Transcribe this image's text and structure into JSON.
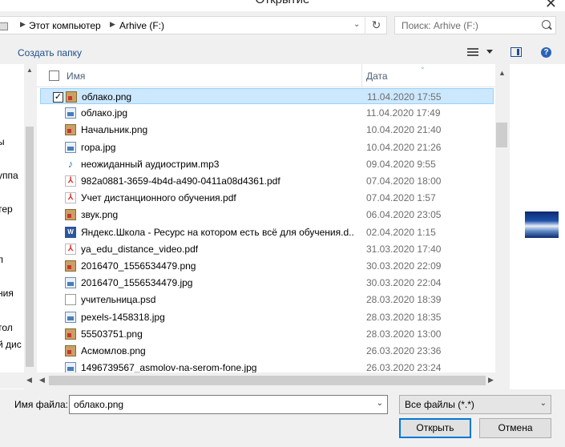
{
  "window": {
    "title": "Открытие"
  },
  "address": {
    "segments": [
      "Этот компьютер",
      "Arhive (F:)"
    ]
  },
  "search": {
    "placeholder": "Поиск: Arhive (F:)"
  },
  "toolbar": {
    "new_folder": "Создать папку",
    "help": "?"
  },
  "nav": {
    "items": [
      "ы",
      "уппа",
      "тер",
      "л",
      "ния",
      "тол",
      "й дис"
    ]
  },
  "columns": {
    "name": "Имя",
    "date": "Дата"
  },
  "files": [
    {
      "name": "облако.png",
      "date": "11.04.2020 17:55",
      "icon": "png-icon",
      "selected": true
    },
    {
      "name": "облако.jpg",
      "date": "11.04.2020 17:49",
      "icon": "jpg-icon"
    },
    {
      "name": "Начальник.png",
      "date": "10.04.2020 21:40",
      "icon": "png-icon"
    },
    {
      "name": "гора.jpg",
      "date": "10.04.2020 21:26",
      "icon": "jpg-icon"
    },
    {
      "name": "неожиданный аудиострим.mp3",
      "date": "09.04.2020 9:55",
      "icon": "audio-icon"
    },
    {
      "name": "982a0881-3659-4b4d-a490-0411a08d4361.pdf",
      "date": "07.04.2020 18:00",
      "icon": "pdf-icon"
    },
    {
      "name": "Учет дистанционного обучения.pdf",
      "date": "07.04.2020 1:57",
      "icon": "pdf-icon"
    },
    {
      "name": "звук.png",
      "date": "06.04.2020 23:05",
      "icon": "png-icon"
    },
    {
      "name": "Яндекс.Школа - Ресурс на котором есть всё для обучения.d...",
      "date": "02.04.2020 1:15",
      "icon": "word-icon"
    },
    {
      "name": "ya_edu_distance_video.pdf",
      "date": "31.03.2020 17:40",
      "icon": "pdf-icon"
    },
    {
      "name": "2016470_1556534479.png",
      "date": "30.03.2020 22:09",
      "icon": "png-icon"
    },
    {
      "name": "2016470_1556534479.jpg",
      "date": "30.03.2020 22:04",
      "icon": "jpg-icon"
    },
    {
      "name": "учительница.psd",
      "date": "28.03.2020 18:39",
      "icon": "psd-icon"
    },
    {
      "name": "pexels-1458318.jpg",
      "date": "28.03.2020 18:35",
      "icon": "jpg-icon"
    },
    {
      "name": "55503751.png",
      "date": "28.03.2020 13:00",
      "icon": "png-icon"
    },
    {
      "name": "Асмомлов.png",
      "date": "26.03.2020 23:36",
      "icon": "png-icon"
    },
    {
      "name": "1496739567_asmolov-na-serom-fone.jpg",
      "date": "26.03.2020 23:24",
      "icon": "jpg-icon"
    }
  ],
  "bottom": {
    "filename_label": "Имя файла:",
    "filename_value": "облако.png",
    "filetype_selected": "Все файлы (*.*)",
    "open_button": "Открыть",
    "cancel_button": "Отмена"
  }
}
